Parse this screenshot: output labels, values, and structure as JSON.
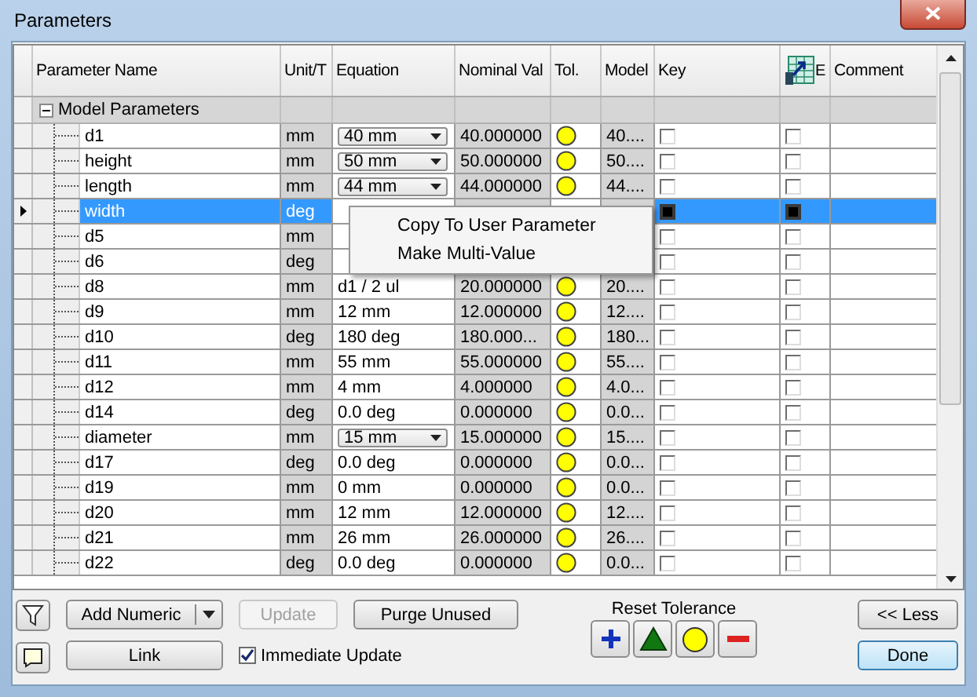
{
  "window": {
    "title": "Parameters"
  },
  "table": {
    "columns": [
      "Parameter Name",
      "Unit/T",
      "Equation",
      "Nominal Val",
      "Tol.",
      "Model",
      "Key",
      "E",
      "Comment"
    ],
    "group": {
      "label": "Model Parameters",
      "expanded": true
    },
    "rows": [
      {
        "name": "d1",
        "unit": "mm",
        "equation": "40 mm",
        "kind": "dropdown",
        "nominal": "40.000000",
        "model": "40....",
        "key": false,
        "export": false,
        "selected": false
      },
      {
        "name": "height",
        "unit": "mm",
        "equation": "50 mm",
        "kind": "dropdown",
        "nominal": "50.000000",
        "model": "50....",
        "key": false,
        "export": false,
        "selected": false
      },
      {
        "name": "length",
        "unit": "mm",
        "equation": "44 mm",
        "kind": "dropdown",
        "nominal": "44.000000",
        "model": "44....",
        "key": false,
        "export": false,
        "selected": false
      },
      {
        "name": "width",
        "unit": "deg",
        "kind": "covered",
        "key": false,
        "export": false,
        "selected": true
      },
      {
        "name": "d5",
        "unit": "mm",
        "kind": "covered",
        "key": false,
        "export": false,
        "selected": false
      },
      {
        "name": "d6",
        "unit": "deg",
        "kind": "covered",
        "key": false,
        "export": false,
        "selected": false
      },
      {
        "name": "d8",
        "unit": "mm",
        "equation": "d1 / 2 ul",
        "kind": "text",
        "nominal": "20.000000",
        "model": "20....",
        "key": false,
        "export": false,
        "selected": false
      },
      {
        "name": "d9",
        "unit": "mm",
        "equation": "12 mm",
        "kind": "text",
        "nominal": "12.000000",
        "model": "12....",
        "key": false,
        "export": false,
        "selected": false
      },
      {
        "name": "d10",
        "unit": "deg",
        "equation": "180 deg",
        "kind": "text",
        "nominal": "180.000...",
        "model": "180...",
        "key": false,
        "export": false,
        "selected": false
      },
      {
        "name": "d11",
        "unit": "mm",
        "equation": "55 mm",
        "kind": "text",
        "nominal": "55.000000",
        "model": "55....",
        "key": false,
        "export": false,
        "selected": false
      },
      {
        "name": "d12",
        "unit": "mm",
        "equation": "4 mm",
        "kind": "text",
        "nominal": "4.000000",
        "model": "4.0...",
        "key": false,
        "export": false,
        "selected": false
      },
      {
        "name": "d14",
        "unit": "deg",
        "equation": "0.0 deg",
        "kind": "text",
        "nominal": "0.000000",
        "model": "0.0...",
        "key": false,
        "export": false,
        "selected": false
      },
      {
        "name": "diameter",
        "unit": "mm",
        "equation": "15 mm",
        "kind": "dropdown",
        "nominal": "15.000000",
        "model": "15....",
        "key": false,
        "export": false,
        "selected": false
      },
      {
        "name": "d17",
        "unit": "deg",
        "equation": "0.0 deg",
        "kind": "text",
        "nominal": "0.000000",
        "model": "0.0...",
        "key": false,
        "export": false,
        "selected": false
      },
      {
        "name": "d19",
        "unit": "mm",
        "equation": "0 mm",
        "kind": "text",
        "nominal": "0.000000",
        "model": "0.0...",
        "key": false,
        "export": false,
        "selected": false
      },
      {
        "name": "d20",
        "unit": "mm",
        "equation": "12 mm",
        "kind": "text",
        "nominal": "12.000000",
        "model": "12....",
        "key": false,
        "export": false,
        "selected": false
      },
      {
        "name": "d21",
        "unit": "mm",
        "equation": "26 mm",
        "kind": "text",
        "nominal": "26.000000",
        "model": "26....",
        "key": false,
        "export": false,
        "selected": false
      },
      {
        "name": "d22",
        "unit": "deg",
        "equation": "0.0 deg",
        "kind": "text",
        "nominal": "0.000000",
        "model": "0.0...",
        "key": false,
        "export": false,
        "selected": false
      }
    ]
  },
  "context_menu": {
    "items": [
      "Copy To User Parameter",
      "Make Multi-Value"
    ]
  },
  "footer": {
    "add_numeric": {
      "label": "Add Numeric",
      "disabled": false
    },
    "update": {
      "label": "Update",
      "disabled": true
    },
    "purge": {
      "label": "Purge Unused",
      "disabled": false
    },
    "link": {
      "label": "Link",
      "disabled": false
    },
    "immediate_update": {
      "label": "Immediate Update",
      "checked": true
    },
    "reset_tolerance": {
      "label": "Reset Tolerance"
    },
    "less": {
      "label": "<< Less",
      "disabled": false
    },
    "done": {
      "label": "Done",
      "disabled": false
    }
  }
}
